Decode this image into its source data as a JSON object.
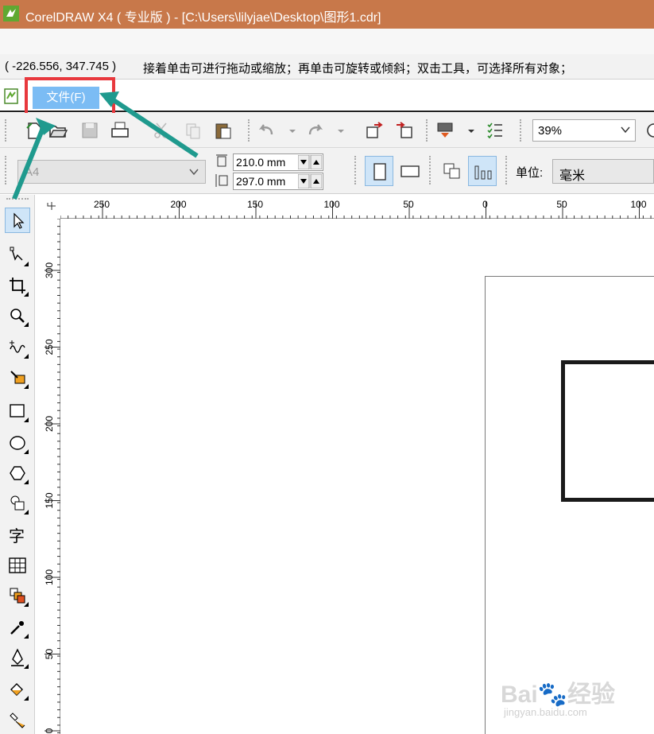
{
  "window": {
    "title": "CorelDRAW X4 ( 专业版 ) - [C:\\Users\\lilyjae\\Desktop\\图形1.cdr]"
  },
  "status": {
    "coordinates": "( -226.556, 347.745 )",
    "hint": "接着单击可进行拖动或缩放；再单击可旋转或倾斜；双击工具，可选择所有对象；"
  },
  "menu": {
    "file_label": "文件(F)"
  },
  "toolbar": {
    "zoom_value": "39%"
  },
  "property_bar": {
    "paper_size": "A4",
    "width": "210.0 mm",
    "height": "297.0 mm",
    "unit_label": "单位:",
    "unit_value": "毫米"
  },
  "rulers": {
    "horizontal": [
      "250",
      "200",
      "150",
      "100",
      "50",
      "0",
      "50",
      "100"
    ],
    "vertical": [
      "300",
      "250",
      "200",
      "150",
      "100",
      "50",
      "0"
    ]
  },
  "toolbox": {
    "text_tool_glyph": "字"
  },
  "watermark": {
    "brand": "Bai",
    "brand_cn": "经验",
    "url": "jingyan.baidu.com"
  },
  "colors": {
    "titlebar": "#c8784a",
    "menu_highlight": "#7bbcf4",
    "annotation_box": "#e8383d",
    "annotation_arrow": "#1f9a8e"
  }
}
